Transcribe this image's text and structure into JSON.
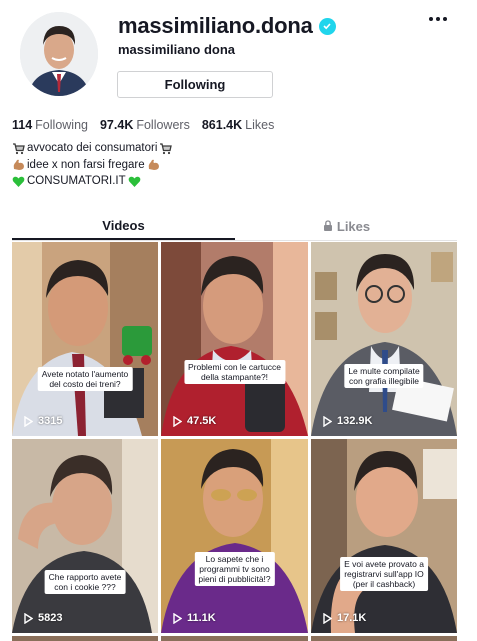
{
  "profile": {
    "username": "massimiliano.dona",
    "display_name": "massimiliano dona",
    "follow_button": "Following",
    "verified_icon": "verified-badge-icon",
    "more_icon": "more-options-icon"
  },
  "stats": {
    "following_count": "114",
    "following_label": "Following",
    "followers_count": "97.4K",
    "followers_label": "Followers",
    "likes_count": "861.4K",
    "likes_label": "Likes"
  },
  "bio": {
    "line1": "avvocato dei consumatori",
    "line2": "idee x non farsi fregare",
    "line3": "CONSUMATORI.IT"
  },
  "tabs": {
    "videos": "Videos",
    "likes": "Likes"
  },
  "videos": [
    {
      "caption1": "Avete notato l'aumento",
      "caption2": "del costo dei treni?",
      "views": "3315"
    },
    {
      "caption1": "Problemi con le cartucce",
      "caption2": "della stampante?!",
      "views": "47.5K"
    },
    {
      "caption1": "Le multe compilate",
      "caption2": "con grafia illegibile",
      "views": "132.9K"
    },
    {
      "caption1": "Che rapporto avete",
      "caption2": "con i cookie ???",
      "views": "5823"
    },
    {
      "caption1": "Lo sapete che i",
      "caption2": "programmi tv sono",
      "caption3": "pieni di pubblicità!?",
      "views": "11.1K"
    },
    {
      "caption1": "E voi avete provato a",
      "caption2": "registrarvi sull'app IO",
      "caption3": "(per il cashback)",
      "views": "17.1K"
    }
  ],
  "colors": {
    "verified": "#20d5ec",
    "text": "#161823",
    "muted": "#5f6068"
  }
}
